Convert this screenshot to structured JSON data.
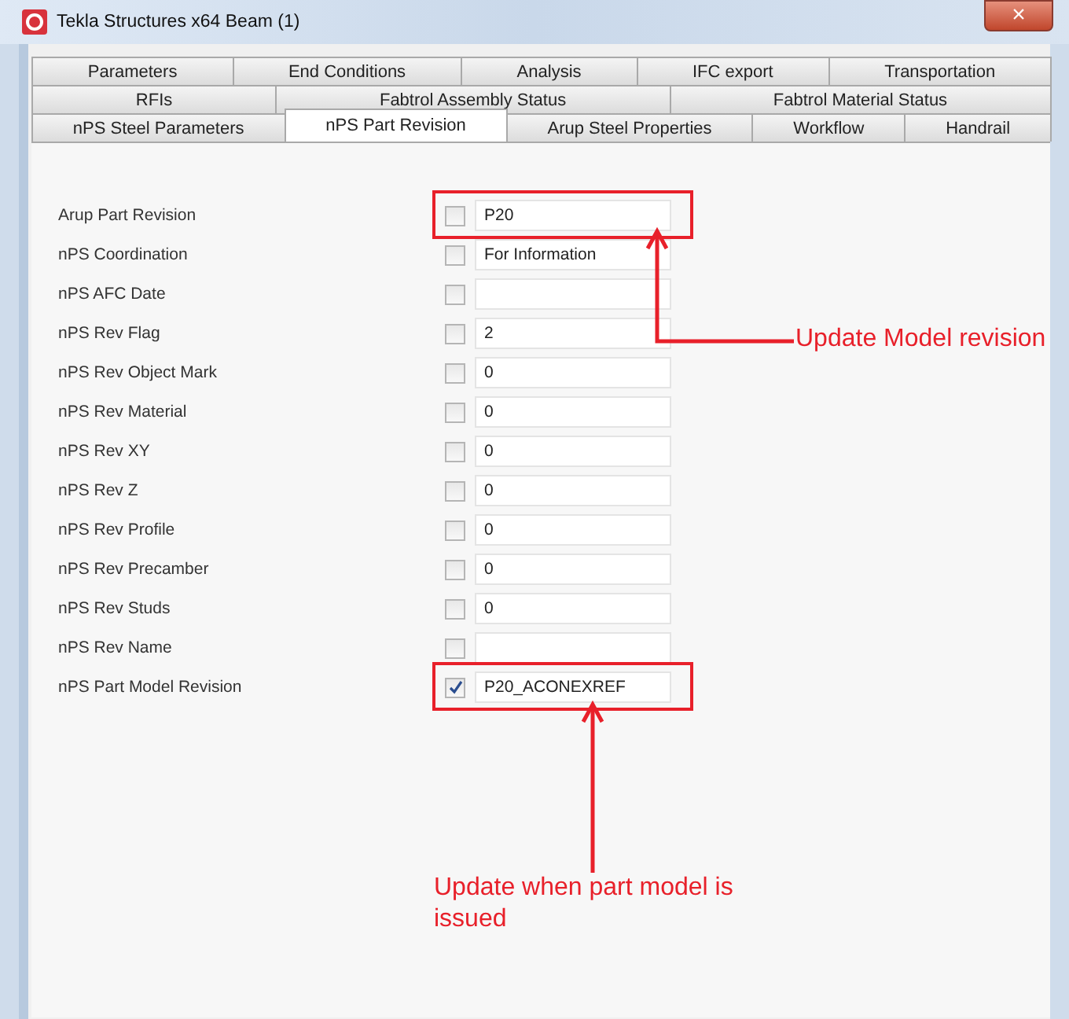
{
  "window": {
    "title": "Tekla Structures x64  Beam (1)",
    "close": "×"
  },
  "tab_rows": [
    [
      {
        "label": "Parameters",
        "selected": false
      },
      {
        "label": "End Conditions",
        "selected": false
      },
      {
        "label": "Analysis",
        "selected": false
      },
      {
        "label": "IFC export",
        "selected": false
      },
      {
        "label": "Transportation",
        "selected": false
      }
    ],
    [
      {
        "label": "RFIs",
        "selected": false
      },
      {
        "label": "Fabtrol Assembly Status",
        "selected": false
      },
      {
        "label": "Fabtrol Material Status",
        "selected": false
      }
    ],
    [
      {
        "label": "nPS Steel Parameters",
        "selected": false
      },
      {
        "label": "nPS Part Revision",
        "selected": true
      },
      {
        "label": "Arup Steel Properties",
        "selected": false
      },
      {
        "label": "Workflow",
        "selected": false
      },
      {
        "label": "Handrail",
        "selected": false
      }
    ]
  ],
  "fields": [
    {
      "label": "Arup Part Revision",
      "checked": false,
      "value": "P20",
      "highlighted": true,
      "note": {
        "kind": "side",
        "text": "Update Model revision"
      }
    },
    {
      "label": "nPS Coordination",
      "checked": false,
      "value": "For Information",
      "highlighted": false
    },
    {
      "label": "nPS AFC Date",
      "checked": false,
      "highlighted": false
    },
    {
      "label": "nPS Rev Flag",
      "checked": false,
      "value": "2",
      "highlighted": false
    },
    {
      "label": "nPS Rev Object Mark",
      "checked": false,
      "value": "0",
      "highlighted": false
    },
    {
      "label": "nPS Rev Material",
      "checked": false,
      "value": "0",
      "highlighted": false
    },
    {
      "label": "nPS Rev XY",
      "checked": false,
      "value": "0",
      "highlighted": false
    },
    {
      "label": "nPS Rev Z",
      "checked": false,
      "value": "0",
      "highlighted": false
    },
    {
      "label": "nPS Rev Profile",
      "checked": false,
      "value": "0",
      "highlighted": false
    },
    {
      "label": "nPS Rev Precamber",
      "checked": false,
      "value": "0",
      "highlighted": false
    },
    {
      "label": "nPS Rev Studs",
      "checked": false,
      "value": "0",
      "highlighted": false
    },
    {
      "label": "nPS Rev Name",
      "checked": false,
      "highlighted": false
    },
    {
      "label": "nPS Part Model Revision",
      "checked": true,
      "value": "P20_ACONEXREF",
      "highlighted": true,
      "note": {
        "kind": "below",
        "text": "Update when part model is issued"
      }
    }
  ]
}
